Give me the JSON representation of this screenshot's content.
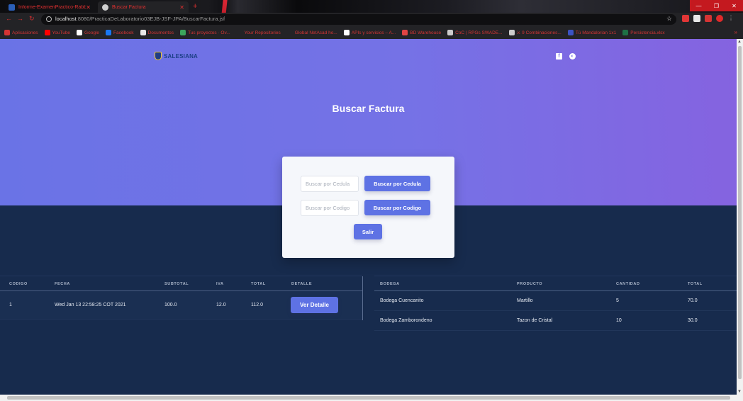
{
  "browser": {
    "tabs": [
      {
        "label": "Informe-ExamenPractico-Rabbyt",
        "icon": "word-icon"
      },
      {
        "label": "Buscar Factura",
        "icon": "globe-icon"
      }
    ],
    "new_tab": "+",
    "url_host": "localhost",
    "url_path": ":8080/PracticaDeLaboratorio03EJB-JSF-JPA/BuscarFactura.jsf",
    "bookmarks": [
      {
        "label": "Aplicaciones",
        "color": "#d43434"
      },
      {
        "label": "YouTube",
        "color": "#ff0000"
      },
      {
        "label": "Google",
        "color": "#ffffff"
      },
      {
        "label": "Facebook",
        "color": "#1877f2"
      },
      {
        "label": "Documentos",
        "color": "#e8e8e8"
      },
      {
        "label": "Tus proyectos · Ov...",
        "color": "#3ca55c"
      },
      {
        "label": "Your Repositories",
        "color": "#232326"
      },
      {
        "label": "Global NetAcad ho...",
        "color": "#232326"
      },
      {
        "label": "APIs y servicios – A...",
        "color": "#ffffff"
      },
      {
        "label": "BD Warehouse",
        "color": "#e04444"
      },
      {
        "label": "CoC | RPGs SWADE...",
        "color": "#cccccc"
      },
      {
        "label": "⚔ 9 Combinaciones...",
        "color": "#cccccc"
      },
      {
        "label": "Tú Mandalorian 1x1",
        "color": "#3b53c4"
      },
      {
        "label": "Persistencia.xlsx",
        "color": "#1e7145"
      }
    ]
  },
  "brand": {
    "logo_text": "SALESIANA",
    "accent": "#5e72e4",
    "hero_start": "#6a73e6",
    "hero_end": "#8563e0",
    "dark_bg": "#172b4d"
  },
  "page": {
    "title": "Buscar Factura"
  },
  "search": {
    "cedula_placeholder": "Buscar por Cedula",
    "cedula_value": "",
    "codigo_placeholder": "Buscar por Codigo",
    "codigo_value": "",
    "btn_cedula": "Buscar por Cedula",
    "btn_codigo": "Buscar por Codigo",
    "btn_salir": "Salir"
  },
  "facturas": {
    "headers": [
      "CODIGO",
      "FECHA",
      "SUBTOTAL",
      "IVA",
      "TOTAL",
      "DETALLE"
    ],
    "rows": [
      {
        "codigo": "1",
        "fecha": "Wed Jan 13 22:58:25 COT 2021",
        "subtotal": "100.0",
        "iva": "12.0",
        "total": "112.0",
        "detalle": "Ver Detalle"
      }
    ]
  },
  "detalles": {
    "headers": [
      "BODEGA",
      "PRODUCTO",
      "CANTIDAD",
      "TOTAL"
    ],
    "rows": [
      {
        "bodega": "Bodega Cuencanito",
        "producto": "Martillo",
        "cantidad": "5",
        "total": "70.0"
      },
      {
        "bodega": "Bodega Zamborondeno",
        "producto": "Tazon de Cristal",
        "cantidad": "10",
        "total": "30.0"
      }
    ]
  }
}
